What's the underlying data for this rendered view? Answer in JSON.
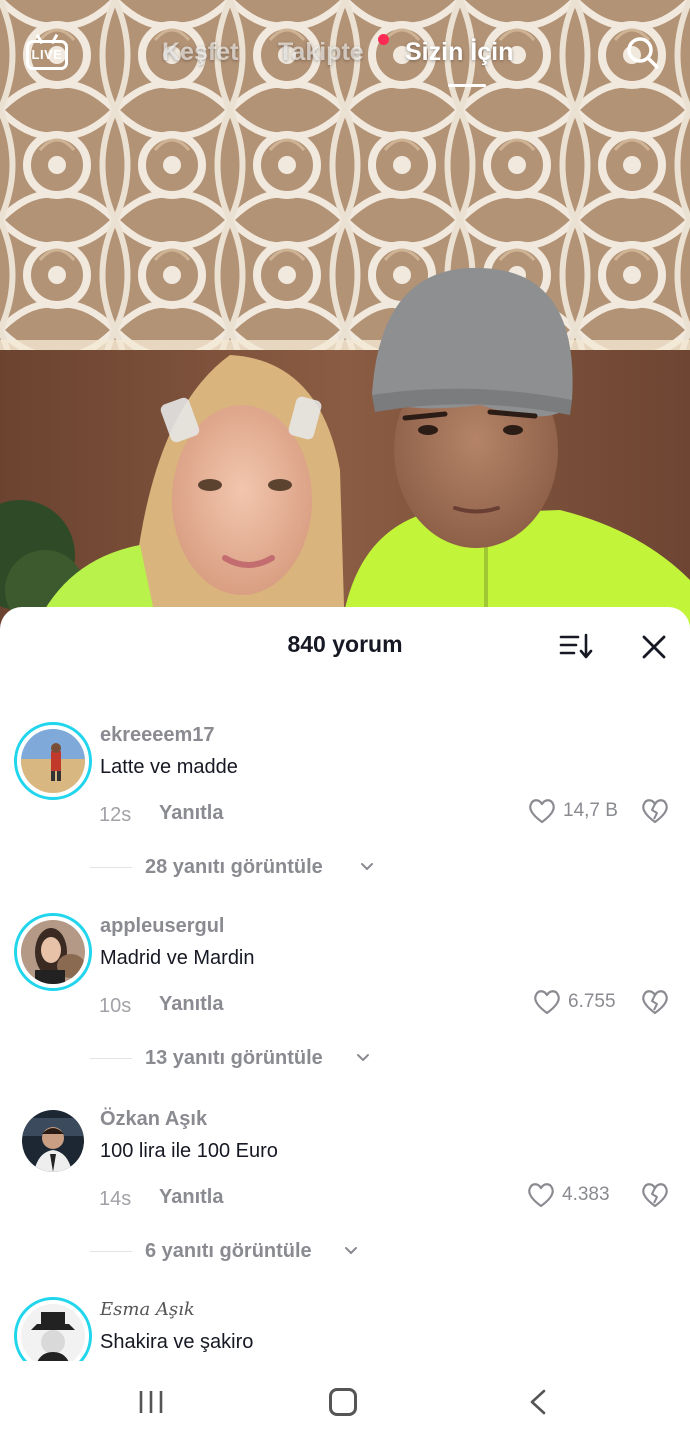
{
  "top_nav": {
    "live_label": "LIVE",
    "tabs": [
      {
        "label": "Keşfet"
      },
      {
        "label": "Takipte"
      },
      {
        "label": "Sizin İçin"
      }
    ]
  },
  "comments_sheet": {
    "title": "840 yorum",
    "comments": [
      {
        "username": "ekreeeem17",
        "text": "Latte ve madde",
        "time": "12s",
        "reply_label": "Yanıtla",
        "likes": "14,7 B",
        "view_replies": "28 yanıtı görüntüle"
      },
      {
        "username": "appleusergul",
        "text": "Madrid ve Mardin",
        "time": "10s",
        "reply_label": "Yanıtla",
        "likes": "6.755",
        "view_replies": "13 yanıtı görüntüle"
      },
      {
        "username": "Özkan Aşık",
        "text": "100 lira ile 100 Euro",
        "time": "14s",
        "reply_label": "Yanıtla",
        "likes": "4.383",
        "view_replies": "6 yanıtı görüntüle"
      },
      {
        "username": "Esma Aşık",
        "text": "Shakira ve şakiro"
      }
    ]
  },
  "colors": {
    "story_ring": "#20d5ec",
    "live_dot": "#fe2c55",
    "primary_text": "#161823",
    "secondary_text": "#8a8b91"
  },
  "icons": [
    "live-tv-icon",
    "search-icon",
    "sort-icon",
    "close-icon",
    "heart-outline-icon",
    "broken-heart-icon",
    "chevron-down-icon",
    "recent-apps-icon",
    "home-icon",
    "back-icon"
  ]
}
